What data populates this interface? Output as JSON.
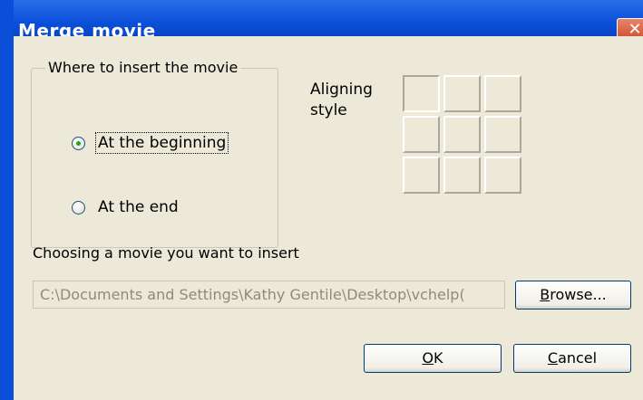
{
  "window": {
    "title": "Merge movie",
    "close_glyph": "✕"
  },
  "insert_group": {
    "legend": "Where to insert the movie",
    "options": [
      {
        "label": "At the beginning",
        "checked": true
      },
      {
        "label": "At the end",
        "checked": false
      }
    ]
  },
  "aligning": {
    "line1": "Aligning",
    "line2": "style",
    "selected_cell": 0
  },
  "movie": {
    "label": "Choosing a movie you want to insert",
    "path": "C:\\Documents and Settings\\Kathy Gentile\\Desktop\\vchelp("
  },
  "buttons": {
    "browse_mnemonic": "B",
    "browse_rest": "rowse...",
    "ok_mnemonic": "O",
    "ok_rest": "K",
    "cancel_mnemonic": "C",
    "cancel_rest": "ancel"
  },
  "colors": {
    "title_bar": "#0a4fd8",
    "dialog_bg": "#ece9d8",
    "radio_dot": "#21a121"
  }
}
